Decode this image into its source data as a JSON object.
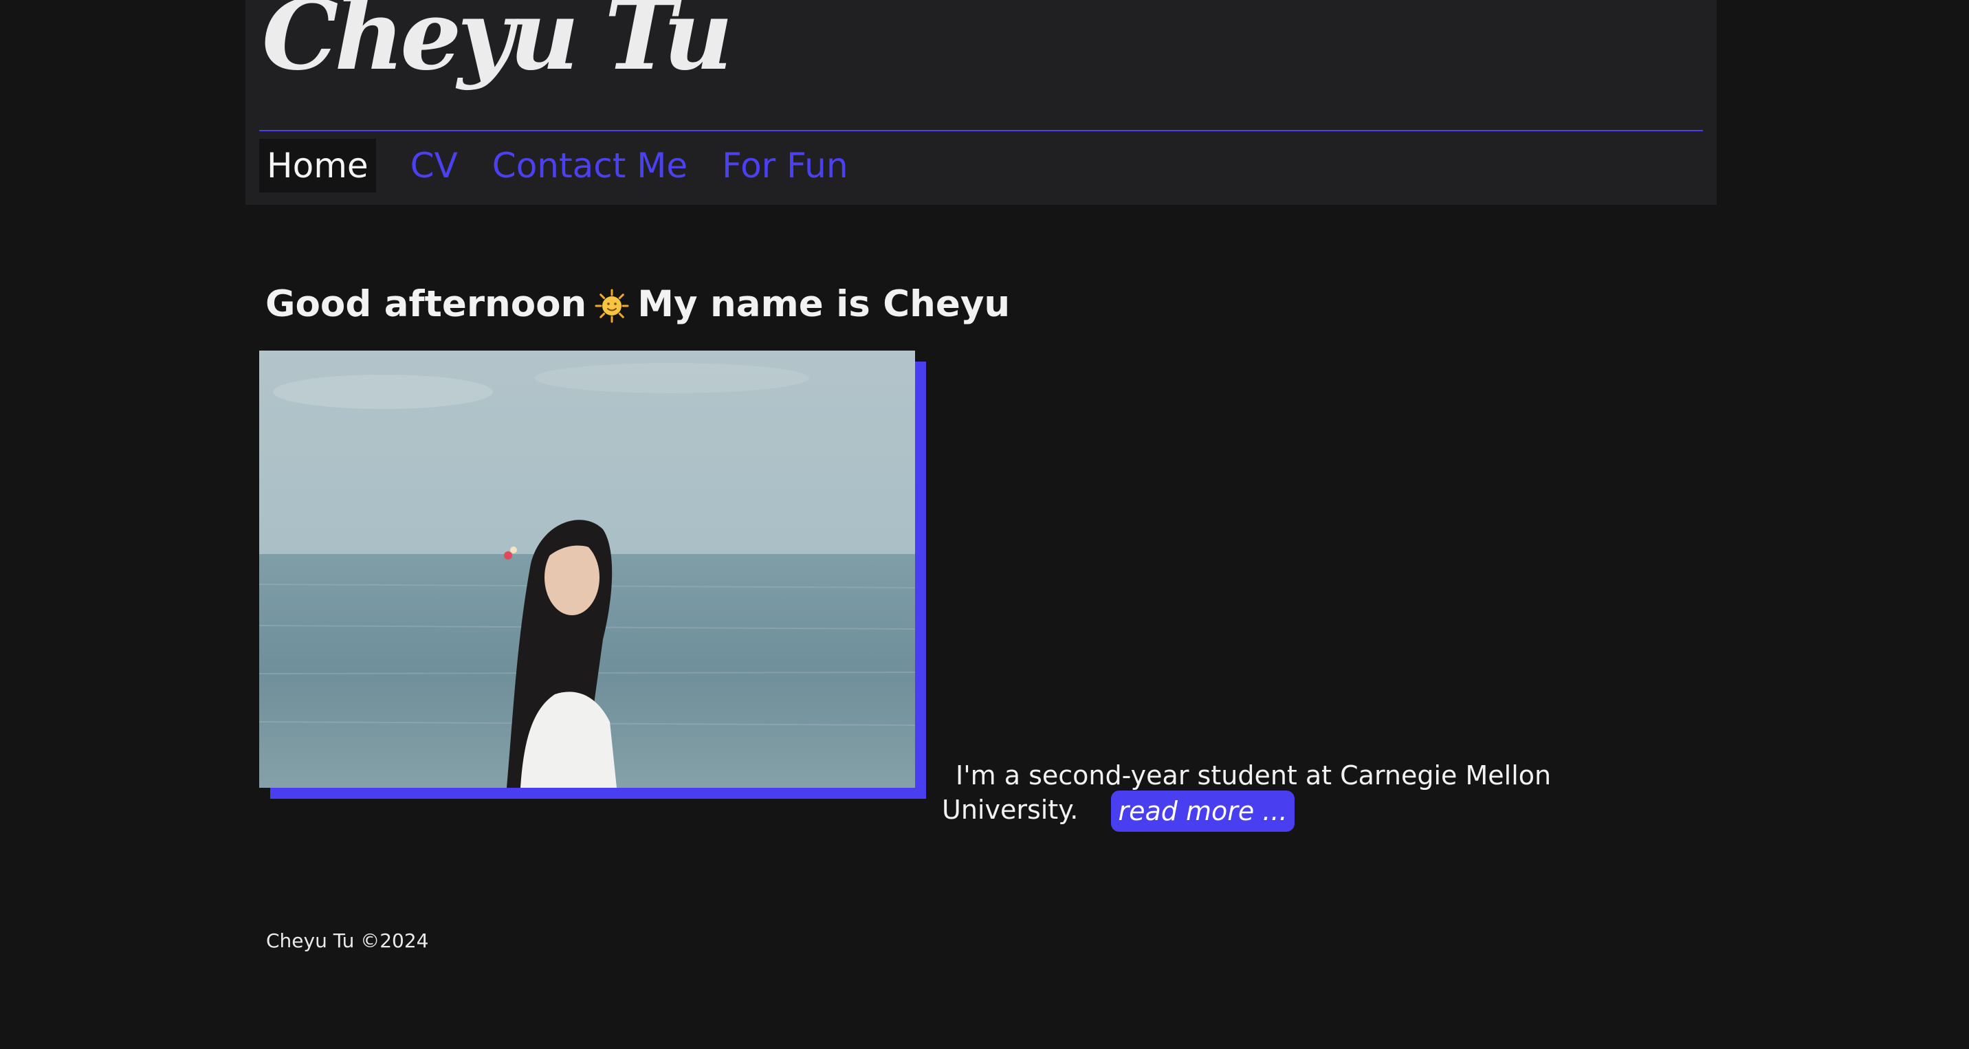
{
  "header": {
    "site_title": "Cheyu Tu"
  },
  "nav": {
    "items": [
      {
        "label": "Home",
        "active": true
      },
      {
        "label": "CV",
        "active": false
      },
      {
        "label": "Contact Me",
        "active": false
      },
      {
        "label": "For Fun",
        "active": false
      }
    ]
  },
  "main": {
    "greeting_prefix": "Good afternoon",
    "greeting_icon": "sun-face-icon",
    "greeting_suffix": "My name is Cheyu",
    "photo_description_icon": "portrait-photo",
    "intro_text": "I'm a second-year student at Carnegie Mellon University.",
    "read_more_label": "read more ..."
  },
  "footer": {
    "copyright": "Cheyu Tu ©2024"
  },
  "colors": {
    "page_background": "#141414",
    "header_background": "#202023",
    "accent": "#4a3ff0",
    "text": "#f2f2f2"
  }
}
